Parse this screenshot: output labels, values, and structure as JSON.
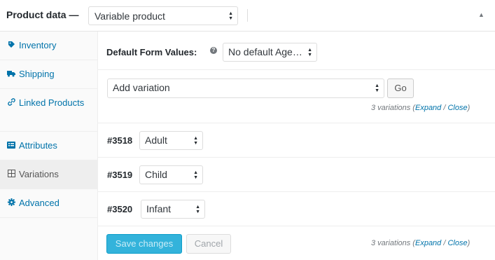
{
  "header": {
    "title": "Product data —",
    "product_type": "Variable product"
  },
  "sidebar": {
    "items": [
      {
        "label": "Inventory",
        "icon": "tag-icon"
      },
      {
        "label": "Shipping",
        "icon": "truck-icon"
      },
      {
        "label": "Linked Products",
        "icon": "link-icon"
      },
      {
        "label": "Attributes",
        "icon": "list-icon"
      },
      {
        "label": "Variations",
        "icon": "grid-icon",
        "active": true
      },
      {
        "label": "Advanced",
        "icon": "gear-icon"
      }
    ]
  },
  "defaults": {
    "label": "Default Form Values:",
    "help": "?",
    "value": "No default Age…"
  },
  "add_variation": {
    "value": "Add variation",
    "go_label": "Go"
  },
  "meta": {
    "count": "3 variations (",
    "expand": "Expand",
    "sep": " / ",
    "close": "Close",
    "end": ")"
  },
  "variations": [
    {
      "id": "#3518",
      "value": "Adult"
    },
    {
      "id": "#3519",
      "value": "Child"
    },
    {
      "id": "#3520",
      "value": "Infant"
    }
  ],
  "footer": {
    "save_label": "Save changes",
    "cancel_label": "Cancel"
  },
  "colors": {
    "link": "#0073aa",
    "primary_button": "#00a0d2"
  }
}
